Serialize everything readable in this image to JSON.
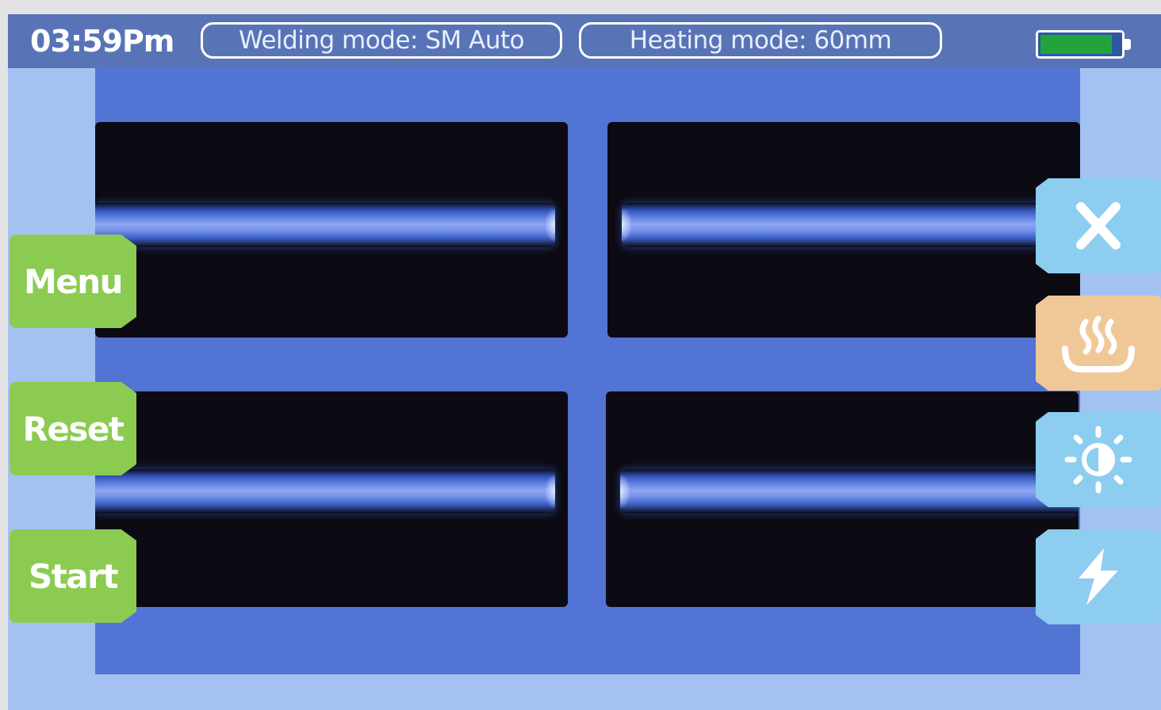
{
  "status_bar": {
    "time": "03:59Pm",
    "welding_mode": "Welding mode: SM Auto",
    "heating_mode": "Heating mode: 60mm",
    "battery_level": 0.9
  },
  "left_buttons": {
    "menu": "Menu",
    "reset": "Reset",
    "start": "Start"
  },
  "right_buttons": {
    "close_icon": "close-icon",
    "heater_icon": "heater-icon",
    "brightness_icon": "brightness-icon",
    "arc_icon": "lightning-icon"
  },
  "colors": {
    "status_bar": "#5874b6",
    "viewport": "#5274d4",
    "left_button": "#8ccb52",
    "right_button": "#8ccdf0",
    "heater_button": "#f0c898",
    "battery_fill": "#22a33c"
  }
}
